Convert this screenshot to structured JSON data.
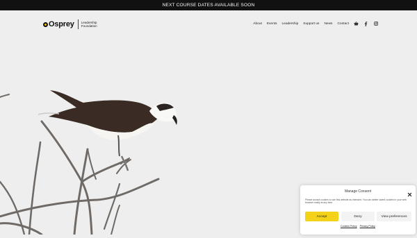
{
  "announcement": "NEXT COURSE DATES AVAILABLE SOON",
  "brand": {
    "name": "Osprey",
    "subtitle_line1": "Leadership",
    "subtitle_line2": "Foundation",
    "accent_color": "#f2c300"
  },
  "nav": {
    "items": [
      "About",
      "Events",
      "Leadership",
      "Support us",
      "News",
      "Contact"
    ],
    "icons": [
      "basket-icon",
      "facebook-icon",
      "instagram-icon"
    ]
  },
  "hero": {
    "image": "osprey-perched-on-branch-photo"
  },
  "consent": {
    "title": "Manage Consent",
    "body": "Please accept cookies to use this website as intended. You can delete saved cookies in your web browser easily at any time.",
    "accept_label": "Accept",
    "deny_label": "Deny",
    "preferences_label": "View preferences",
    "cookie_policy_link": "Cookies Policy",
    "privacy_policy_link": "Privacy Policy",
    "accept_color": "#f4d21a"
  }
}
